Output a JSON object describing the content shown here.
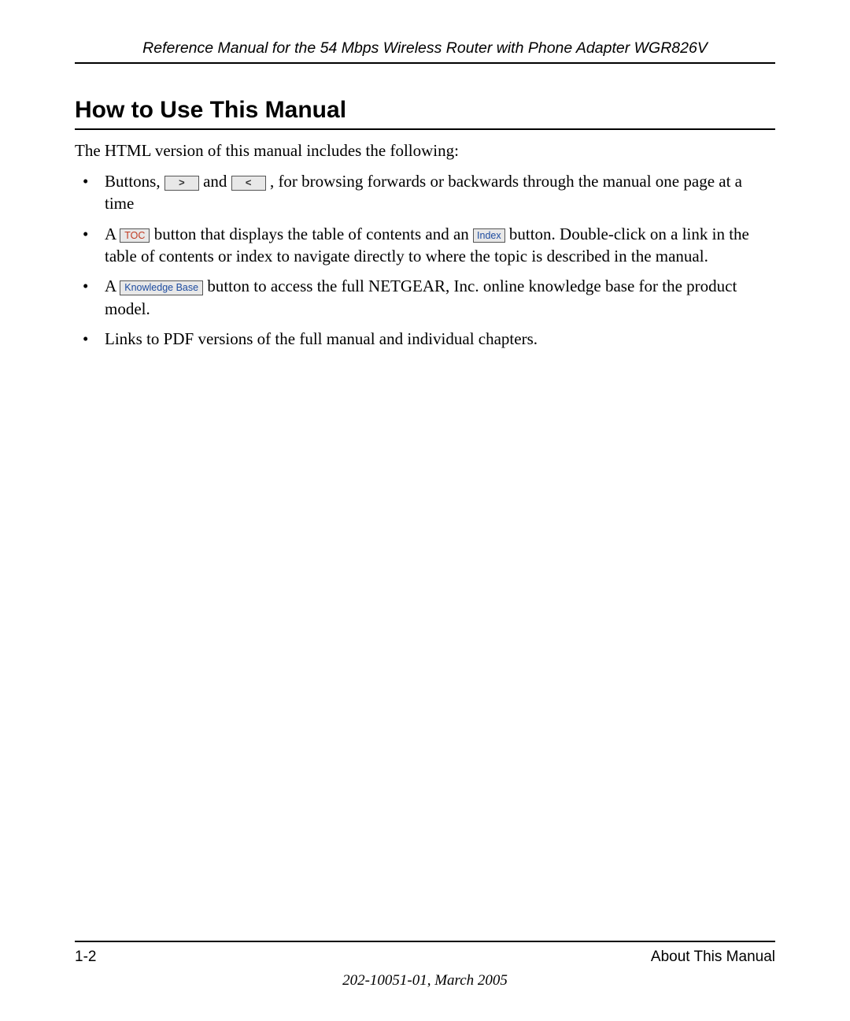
{
  "header": {
    "title": "Reference Manual for the 54 Mbps Wireless Router with Phone Adapter WGR826V"
  },
  "section": {
    "heading": "How to Use This Manual",
    "intro": "The HTML version of this manual includes the following:"
  },
  "buttons": {
    "forward": ">",
    "back": "<",
    "toc": "TOC",
    "index": "Index",
    "kb": "Knowledge Base"
  },
  "bullets": {
    "b1_a": "Buttons, ",
    "b1_b": " and ",
    "b1_c": " , for browsing forwards or backwards through the manual one page at a time",
    "b2_a": "A ",
    "b2_b": " button that displays the table of contents and an ",
    "b2_c": " button. Double-click on a link in the table of contents or index to navigate directly to where the topic is described in the manual.",
    "b3_a": "A ",
    "b3_b": " button to access the full NETGEAR, Inc. online knowledge base for the product model.",
    "b4": "Links to PDF versions of the full manual and individual chapters."
  },
  "footer": {
    "page": "1-2",
    "section": "About This Manual",
    "docid": "202-10051-01, March 2005"
  }
}
